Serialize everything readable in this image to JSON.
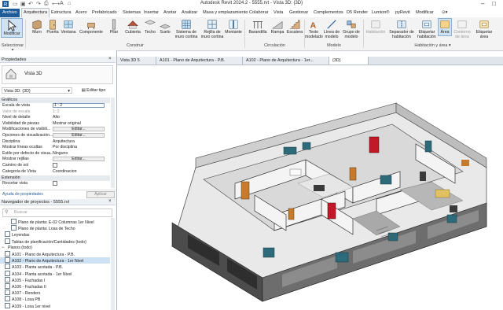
{
  "title": "Autodesk Revit 2024.2 - 5555.rvt - Vista 3D: {3D}",
  "menu": {
    "file": "Archivo",
    "tabs": [
      "Arquitectura",
      "Estructura",
      "Acero",
      "Prefabricado",
      "Sistemas",
      "Insertar",
      "Anotar",
      "Analizar",
      "Masa y emplazamiento",
      "Colaborar",
      "Vista",
      "Gestionar",
      "Complementos",
      "D5 Render",
      "Lumion®",
      "pyRevit",
      "Modificar"
    ]
  },
  "ribbon": {
    "buttons": [
      "Modificar",
      "Muro",
      "Puerta",
      "Ventana",
      "Componente",
      "Pilar",
      "Cubierta",
      "Techo",
      "Suelo",
      "Sistema de muro cortina",
      "Rejilla de muro cortina",
      "Montante",
      "Barandilla",
      "Rampa",
      "Escalera",
      "Texto modelado",
      "Línea de modelo",
      "Grupo de modelo",
      "Habitación",
      "Separador de habitación",
      "Etiquetar habitación",
      "Área",
      "Contorno de área",
      "Etiquetar área"
    ],
    "groups": [
      "Seleccionar",
      "Construir",
      "Circulación",
      "Modelo",
      "Habitación y área"
    ]
  },
  "properties": {
    "header": "Propiedades",
    "type_name": "Vista 3D",
    "selector": "Vista 3D: {3D}",
    "edit_type": "Editar tipo",
    "category_graphics": "Gráficos",
    "rows": [
      {
        "k": "Escala de vista",
        "v": "1 : 2"
      },
      {
        "k": "Valor de escala",
        "v": "1:  2"
      },
      {
        "k": "Nivel de detalle",
        "v": "Alto"
      },
      {
        "k": "Visibilidad de piezas",
        "v": "Mostrar original"
      },
      {
        "k": "Modificaciones de visibili...",
        "v": "Editar..."
      },
      {
        "k": "Opciones de visualización...",
        "v": "Editar..."
      },
      {
        "k": "Disciplina",
        "v": "Arquitectura"
      },
      {
        "k": "Mostrar líneas ocultas",
        "v": "Por disciplina"
      },
      {
        "k": "Estilo por defecto de visua...",
        "v": "Ninguno"
      },
      {
        "k": "Mostrar rejillas",
        "v": "Editar..."
      },
      {
        "k": "Camino de sol",
        "v": ""
      },
      {
        "k": "Categoría de Vista",
        "v": "Coordinacion"
      }
    ],
    "category_extent": "Extensión",
    "extent_rows": [
      {
        "k": "Recortar vista",
        "v": ""
      }
    ],
    "help": "Ayuda de propiedades",
    "apply": "Aplicar"
  },
  "browser": {
    "header": "Navegador de proyectos - 5555.rvt",
    "search_placeholder": "Buscar",
    "items": [
      "Plano de planta: E-02 Columnas 1er Nivel",
      "Plano de planta: Losa de Techo",
      "Leyendas",
      "Tablas de planificación/Cantidades (todo)",
      "Planos (todo)",
      "A101 - Plano de Arquitectura - P.B.",
      "A102 - Plano de Arquitectura - 1er Nivel",
      "A103 - Planta acotada - P.B.",
      "A104 - Planta acotada - 1er Nivel",
      "A105 - Fachadas I",
      "A106 - Fachadas II",
      "A107 - Renders",
      "A108 - Losa PB",
      "A109 - Losa 1er nivel"
    ]
  },
  "view_tabs": [
    "Vista 3D 5",
    "A101 - Plano de Arquitectura - P.B.",
    "A102 - Plano de Arquitectura - 1er...",
    "{3D}"
  ],
  "colors": {
    "file_tab": "#1f5a99",
    "selection": "#cfe2f3",
    "door_red": "#c0192a",
    "door_orange": "#c77a2e"
  }
}
